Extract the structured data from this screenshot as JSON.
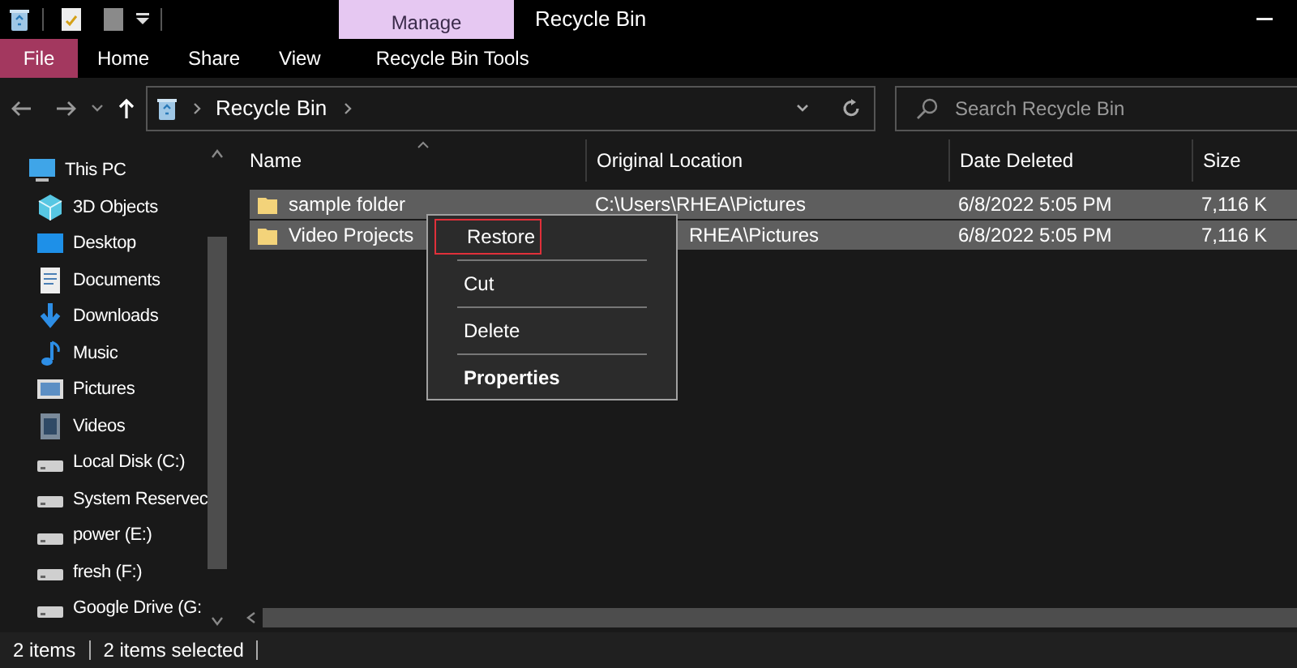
{
  "window": {
    "title": "Recycle Bin",
    "context_tab": "Manage"
  },
  "ribbon_tabs": [
    {
      "label": "File",
      "kind": "file"
    },
    {
      "label": "Home",
      "kind": "tab"
    },
    {
      "label": "Share",
      "kind": "tab"
    },
    {
      "label": "View",
      "kind": "tab"
    },
    {
      "label": "Recycle Bin Tools",
      "kind": "tab"
    }
  ],
  "address": {
    "crumb": "Recycle Bin"
  },
  "search": {
    "placeholder": "Search Recycle Bin"
  },
  "sidebar": {
    "items": [
      {
        "label": "This PC",
        "kind": "pc",
        "children": [
          {
            "label": "3D Objects",
            "kind": "cube"
          },
          {
            "label": "Desktop",
            "kind": "desktop"
          },
          {
            "label": "Documents",
            "kind": "doc"
          },
          {
            "label": "Downloads",
            "kind": "download"
          },
          {
            "label": "Music",
            "kind": "music"
          },
          {
            "label": "Pictures",
            "kind": "pictures"
          },
          {
            "label": "Videos",
            "kind": "videos"
          },
          {
            "label": "Local Disk (C:)",
            "kind": "drive"
          },
          {
            "label": "System Reservec",
            "kind": "drive"
          },
          {
            "label": "power (E:)",
            "kind": "drive"
          },
          {
            "label": "fresh (F:)",
            "kind": "drive"
          },
          {
            "label": "Google Drive (G:",
            "kind": "drive"
          }
        ]
      }
    ]
  },
  "table": {
    "columns": [
      "Name",
      "Original Location",
      "Date Deleted",
      "Size"
    ],
    "rows": [
      {
        "name": "sample folder",
        "location": "C:\\Users\\RHEA\\Pictures",
        "date": "6/8/2022 5:05 PM",
        "size": "7,116 K",
        "selected": true
      },
      {
        "name": "Video Projects",
        "location": "RHEA\\Pictures",
        "date": "6/8/2022 5:05 PM",
        "size": "7,116 K",
        "selected": true
      }
    ]
  },
  "context_menu": {
    "items": [
      {
        "label": "Restore",
        "highlighted": true,
        "bold": false
      },
      {
        "label": "Cut",
        "highlighted": false,
        "bold": false
      },
      {
        "label": "Delete",
        "highlighted": false,
        "bold": false
      },
      {
        "label": "Properties",
        "highlighted": false,
        "bold": true
      }
    ]
  },
  "status_bar": {
    "items": [
      "2 items",
      "2 items selected"
    ]
  }
}
